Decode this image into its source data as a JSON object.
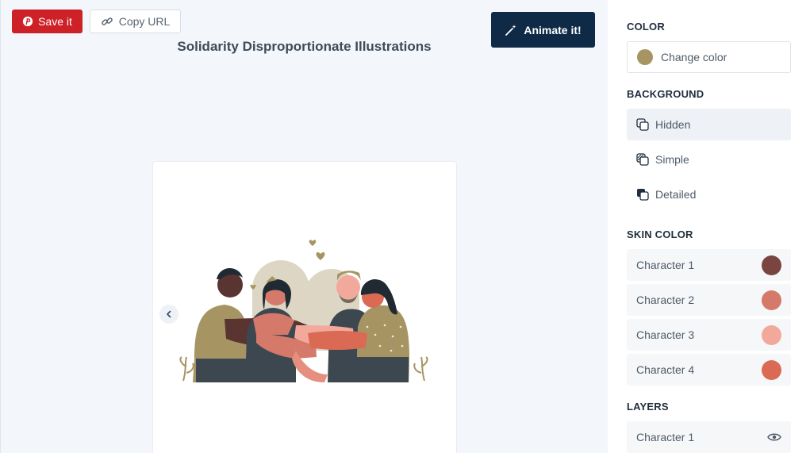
{
  "toolbar": {
    "save_label": "Save it",
    "copy_label": "Copy URL",
    "animate_label": "Animate it!"
  },
  "page": {
    "title": "Solidarity Disproportionate Illustrations"
  },
  "sidebar": {
    "color": {
      "heading": "COLOR",
      "change_label": "Change color",
      "swatch": "#a69563"
    },
    "background": {
      "heading": "BACKGROUND",
      "options": [
        {
          "label": "Hidden",
          "selected": true
        },
        {
          "label": "Simple",
          "selected": false
        },
        {
          "label": "Detailed",
          "selected": false
        }
      ]
    },
    "skin": {
      "heading": "SKIN COLOR",
      "items": [
        {
          "label": "Character 1",
          "color": "#7a4541"
        },
        {
          "label": "Character 2",
          "color": "#d57a6a"
        },
        {
          "label": "Character 3",
          "color": "#f3a89c"
        },
        {
          "label": "Character 4",
          "color": "#db6a55"
        }
      ]
    },
    "layers": {
      "heading": "LAYERS",
      "items": [
        {
          "label": "Character 1"
        }
      ]
    }
  },
  "colors": {
    "pinterest": "#cd2127",
    "navy": "#0e2a47",
    "accent": "#a69563"
  }
}
